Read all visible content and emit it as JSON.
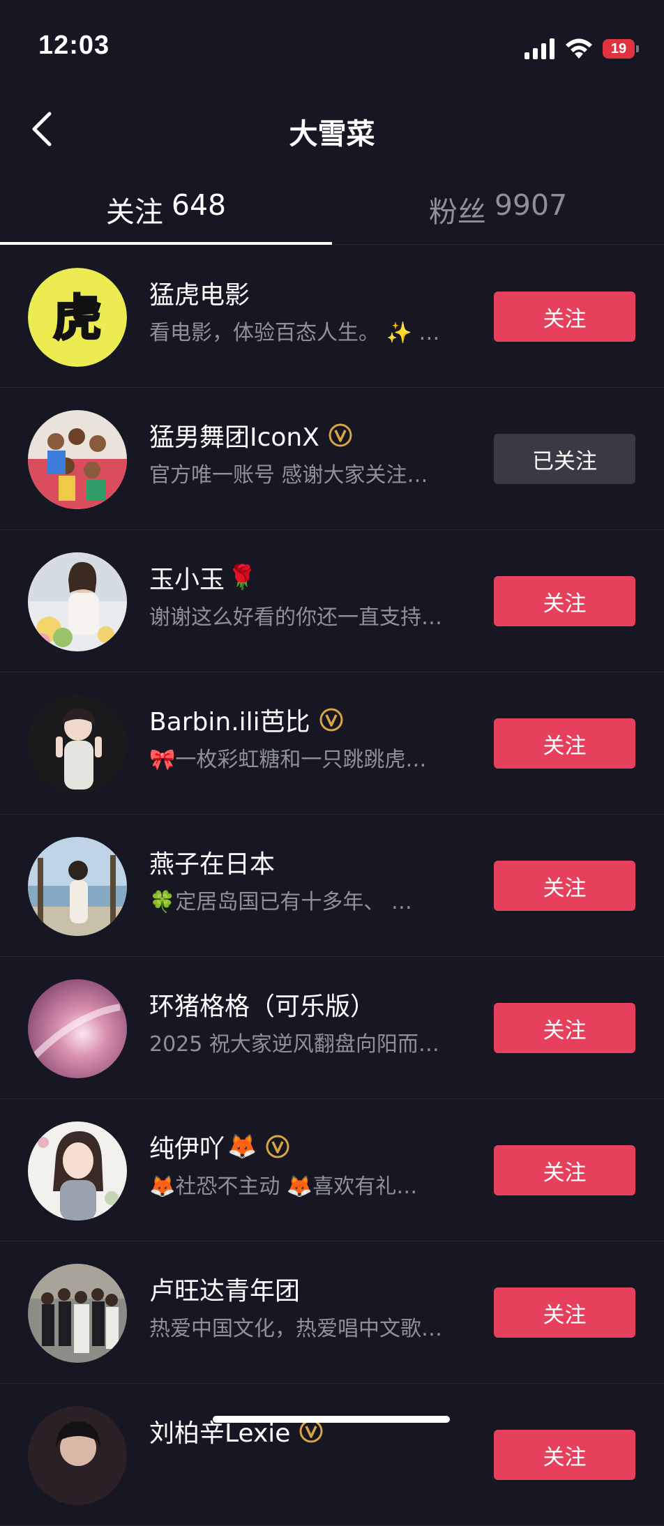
{
  "status_bar": {
    "time": "12:03",
    "battery": "19"
  },
  "header": {
    "title": "大雪菜"
  },
  "tabs": [
    {
      "label": "关注",
      "count": "648",
      "active": true
    },
    {
      "label": "粉丝",
      "count": "9907",
      "active": false
    }
  ],
  "users": [
    {
      "name": "猛虎电影",
      "bio": "看电影，体验百态人生。 ✨ …",
      "verified": false,
      "button": "关注",
      "followed": false,
      "avatar": "tiger-logo"
    },
    {
      "name": "猛男舞团IconX",
      "bio": "官方唯一账号 感谢大家关注…",
      "verified": true,
      "button": "已关注",
      "followed": true,
      "avatar": "group-photo"
    },
    {
      "name": "玉小玉",
      "name_emoji": "🌹",
      "bio": "谢谢这么好看的你还一直支持…",
      "verified": false,
      "button": "关注",
      "followed": false,
      "avatar": "woman-flowers"
    },
    {
      "name": "Barbin.ili芭比",
      "bio": "🎀一枚彩虹糖和一只跳跳虎…",
      "verified": true,
      "button": "关注",
      "followed": false,
      "avatar": "woman-dark"
    },
    {
      "name": "燕子在日本",
      "bio": "🍀定居岛国已有十多年、 …",
      "verified": false,
      "button": "关注",
      "followed": false,
      "avatar": "woman-beach"
    },
    {
      "name": "环猪格格（可乐版）",
      "bio": "2025 祝大家逆风翻盘向阳而…",
      "verified": false,
      "button": "关注",
      "followed": false,
      "avatar": "pink-galaxy"
    },
    {
      "name": "纯伊吖",
      "name_emoji": "🦊",
      "bio": "🦊社恐不主动 🦊喜欢有礼…",
      "verified": true,
      "button": "关注",
      "followed": false,
      "avatar": "anime-girl"
    },
    {
      "name": "卢旺达青年团",
      "bio": "热爱中国文化，热爱唱中文歌…",
      "verified": false,
      "button": "关注",
      "followed": false,
      "avatar": "group-formal"
    },
    {
      "name": "刘柏辛Lexie",
      "bio": "",
      "verified": true,
      "button": "关注",
      "followed": false,
      "avatar": "woman-partial"
    }
  ],
  "colors": {
    "background": "#161722",
    "follow_button": "#e6405d",
    "followed_button": "#393a44",
    "verified": "#d9a441",
    "secondary_text": "#8f9098"
  }
}
